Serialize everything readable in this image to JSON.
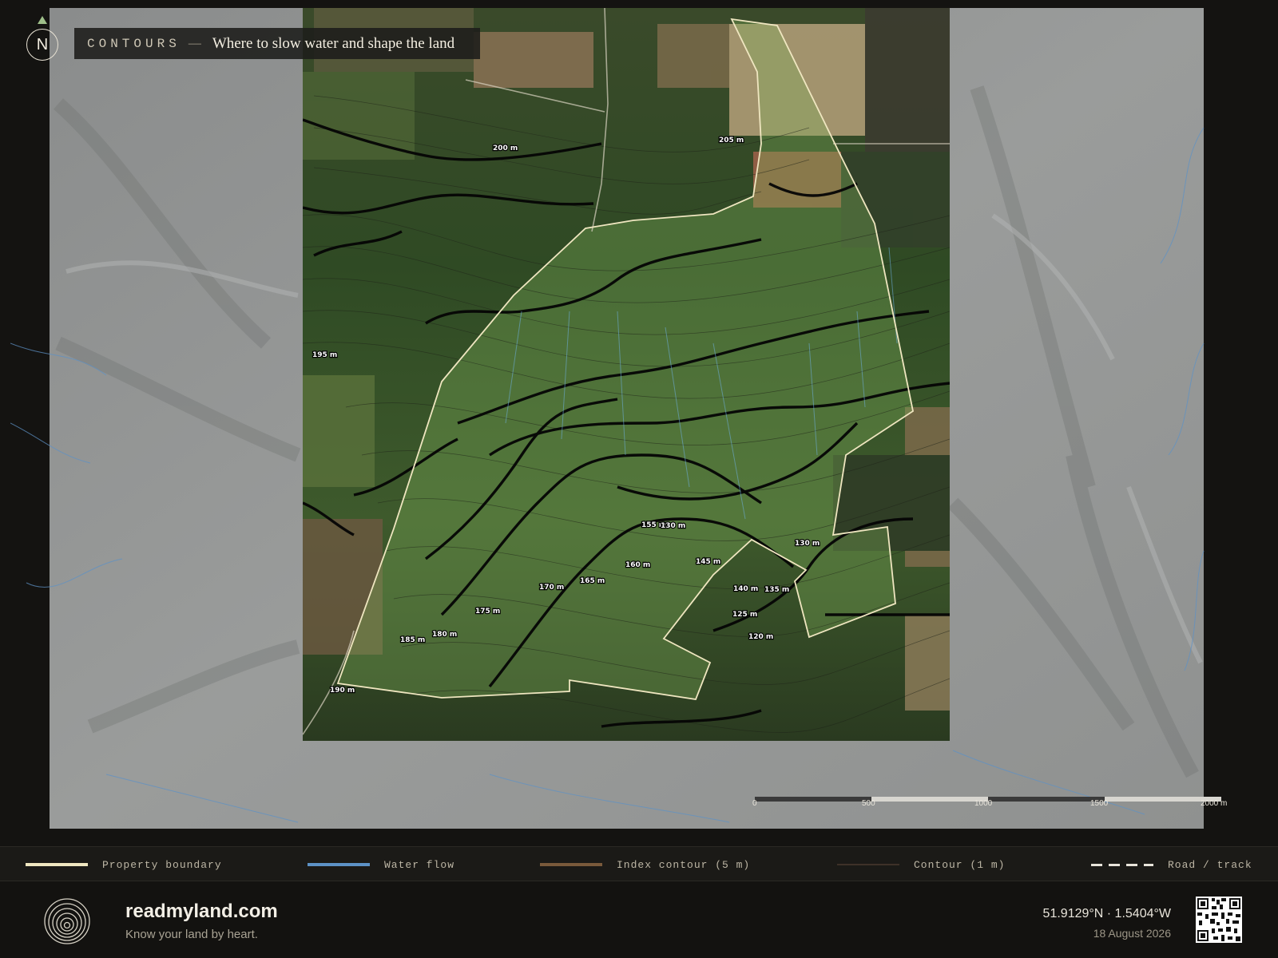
{
  "header": {
    "kicker": "CONTOURS",
    "dash": "—",
    "subtitle": "Where to slow water and shape the land",
    "north": "N"
  },
  "contour_labels": [
    "205 m",
    "200 m",
    "195 m",
    "190 m",
    "185 m",
    "180 m",
    "175 m",
    "170 m",
    "165 m",
    "160 m",
    "155 m",
    "130 m",
    "145 m",
    "140 m",
    "135 m",
    "125 m",
    "120 m",
    "130 m"
  ],
  "scale_bar": {
    "ticks": [
      "0",
      "500",
      "1000",
      "1500",
      "2000 m"
    ]
  },
  "legend": {
    "boundary": "Property boundary",
    "water": "Water flow",
    "index_contour": "Index contour (5 m)",
    "contour": "Contour (1 m)",
    "road": "Road / track",
    "colors": {
      "boundary": "#efe6c0",
      "water": "#5d92c6",
      "index_contour": "#7a5a3b",
      "contour": "#3e3128",
      "road": "#e8e4da"
    }
  },
  "footer": {
    "brand": "readmyland.com",
    "tagline": "Know your land by heart.",
    "coordinates": "51.9129°N · 1.5404°W",
    "date": "18 August 2026"
  }
}
